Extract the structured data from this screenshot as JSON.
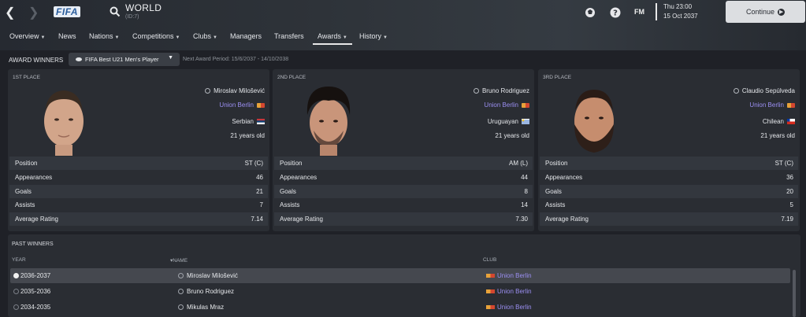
{
  "header": {
    "title": "WORLD",
    "id": "(ID:7)",
    "logo": "FIFA",
    "fm_label": "FM",
    "day_time": "Thu 23:00",
    "date": "15 Oct 2037",
    "continue_label": "Continue"
  },
  "tabs": [
    "Overview",
    "News",
    "Nations",
    "Competitions",
    "Clubs",
    "Managers",
    "Transfers",
    "Awards",
    "History"
  ],
  "award": {
    "label": "AWARD WINNERS",
    "selected": "FIFA Best U21 Men's Player",
    "next_period": "Next Award Period: 15/6/2037 - 14/10/2038"
  },
  "stat_labels": [
    "Position",
    "Appearances",
    "Goals",
    "Assists",
    "Average Rating"
  ],
  "winners": [
    {
      "place": "1ST PLACE",
      "name": "Miroslav Milošević",
      "club": "Union Berlin",
      "nationality": "Serbian",
      "age": "21 years old",
      "stats": [
        "ST (C)",
        "46",
        "21",
        "7",
        "7.14"
      ]
    },
    {
      "place": "2ND PLACE",
      "name": "Bruno Rodriguez",
      "club": "Union Berlin",
      "nationality": "Uruguayan",
      "age": "21 years old",
      "stats": [
        "AM (L)",
        "44",
        "8",
        "14",
        "7.30"
      ]
    },
    {
      "place": "3RD PLACE",
      "name": "Claudio Sepúlveda",
      "club": "Union Berlin",
      "nationality": "Chilean",
      "age": "21 years old",
      "stats": [
        "ST (C)",
        "36",
        "20",
        "5",
        "7.19"
      ]
    }
  ],
  "past": {
    "title": "PAST WINNERS",
    "col_year": "YEAR",
    "col_name": "NAME",
    "col_club": "CLUB",
    "rows": [
      {
        "year": "2036-2037",
        "name": "Miroslav Milošević",
        "club": "Union Berlin"
      },
      {
        "year": "2035-2036",
        "name": "Bruno Rodriguez",
        "club": "Union Berlin"
      },
      {
        "year": "2034-2035",
        "name": "Mikulas Mraz",
        "club": "Union Berlin"
      }
    ]
  },
  "colors": {
    "accent_club": "#9b8ff2",
    "background": "#1f2127",
    "card": "#2a2d33"
  },
  "icons": [
    "back-arrow-icon",
    "forward-arrow-icon",
    "search-icon",
    "award-icon",
    "help-icon",
    "eye-icon",
    "chevron-down-icon",
    "person-icon",
    "club-flag-icon",
    "nation-flag-icon",
    "radio-icon",
    "play-icon"
  ]
}
